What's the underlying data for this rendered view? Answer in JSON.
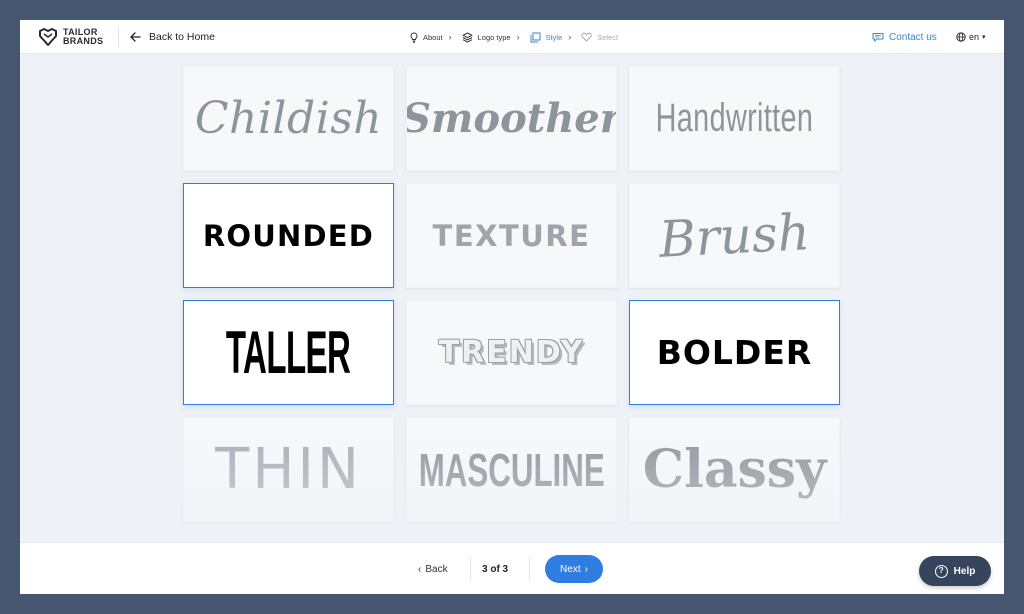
{
  "header": {
    "logo": {
      "line1": "TAILOR",
      "line2": "BRANDS"
    },
    "back_home_label": "Back to Home",
    "steps": [
      {
        "label": "About",
        "state": "done",
        "icon": "bulb-icon"
      },
      {
        "label": "Logo type",
        "state": "done",
        "icon": "layers-icon"
      },
      {
        "label": "Style",
        "state": "active",
        "icon": "copy-icon"
      },
      {
        "label": "Select",
        "state": "disabled",
        "icon": "heart-icon"
      }
    ],
    "contact_label": "Contact us",
    "language": "en"
  },
  "styles": [
    {
      "label": "Childish",
      "selected": false
    },
    {
      "label": "Smoother",
      "selected": false
    },
    {
      "label": "Handwritten",
      "selected": false
    },
    {
      "label": "ROUNDED",
      "selected": true
    },
    {
      "label": "TEXTURE",
      "selected": false
    },
    {
      "label": "Brush",
      "selected": false
    },
    {
      "label": "TALLER",
      "selected": true
    },
    {
      "label": "TRENDY",
      "selected": false
    },
    {
      "label": "BOLDER",
      "selected": true
    },
    {
      "label": "THIN",
      "selected": false
    },
    {
      "label": "MASCULINE",
      "selected": false
    },
    {
      "label": "Classy",
      "selected": false
    }
  ],
  "footer": {
    "back_label": "Back",
    "page_count": "3 of 3",
    "next_label": "Next",
    "help_label": "Help"
  },
  "colors": {
    "accent": "#2f7de1",
    "frame": "#465671",
    "help_bg": "#36455c"
  }
}
